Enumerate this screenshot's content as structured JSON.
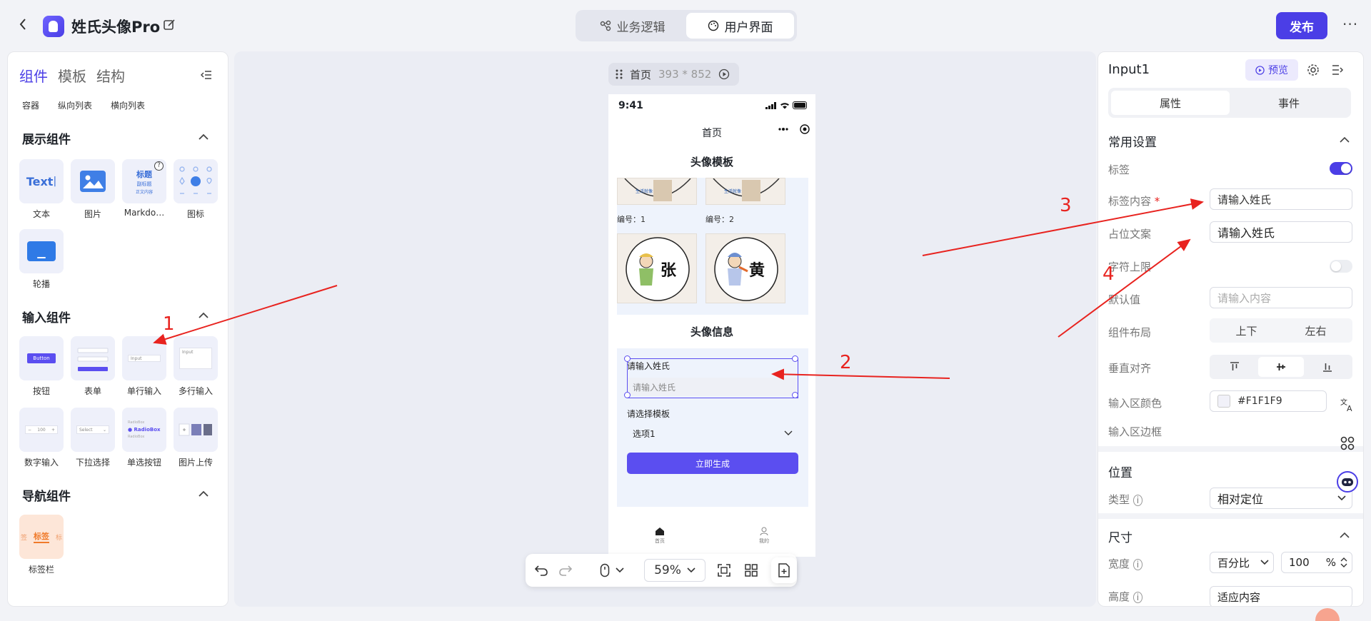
{
  "header": {
    "app_title": "姓氏头像Pro",
    "modes": [
      "业务逻辑",
      "用户界面"
    ],
    "publish_label": "发布",
    "more_label": "···"
  },
  "left_panel": {
    "tabs": [
      "组件",
      "模板",
      "结构"
    ],
    "layout_items": [
      "容器",
      "纵向列表",
      "横向列表"
    ],
    "display_section": {
      "title": "展示组件",
      "items": [
        "文本",
        "图片",
        "Markdo…",
        "图标",
        "轮播"
      ],
      "text_sample": "Text",
      "markdown_sample": [
        "标题",
        "副标题",
        "正文内容"
      ]
    },
    "input_section": {
      "title": "输入组件",
      "items": [
        "按钮",
        "表单",
        "单行输入",
        "多行输入",
        "数字输入",
        "下拉选择",
        "单选按钮",
        "图片上传"
      ],
      "button_sample": "Button",
      "input_sample": "Input",
      "number_sample": "100",
      "select_sample": "Select",
      "radio_sample": "RadioBox"
    },
    "nav_section": {
      "title": "导航组件",
      "items": [
        "标签栏"
      ],
      "tab_sample": [
        "签",
        "标签",
        "标"
      ]
    }
  },
  "canvas": {
    "page_name": "首页",
    "page_size": "393 * 852",
    "zoom": "59%",
    "phone": {
      "time": "9:41",
      "nav_title": "首页",
      "gallery_title": "头像模板",
      "gallery_items": [
        {
          "num": "编号：1",
          "char": "张"
        },
        {
          "num": "编号：2",
          "char": "黄"
        }
      ],
      "info_title": "头像信息",
      "surname_label": "请输入姓氏",
      "surname_placeholder": "请输入姓氏",
      "template_label": "请选择模板",
      "template_value": "选项1",
      "generate_label": "立即生成",
      "tabs": [
        "首页",
        "我的"
      ]
    }
  },
  "right_panel": {
    "component_name": "Input1",
    "preview_label": "预览",
    "tabs": [
      "属性",
      "事件"
    ],
    "common": {
      "title": "常用设置",
      "label_toggle_label": "标签",
      "label_toggle_on": true,
      "label_content_label": "标签内容",
      "label_content_value": "请输入姓氏",
      "placeholder_label": "占位文案",
      "placeholder_value": "请输入姓氏",
      "maxlen_label": "字符上限",
      "maxlen_on": false,
      "default_label": "默认值",
      "default_placeholder": "请输入内容",
      "layout_label": "组件布局",
      "layout_options": [
        "上下",
        "左右"
      ],
      "valign_label": "垂直对齐",
      "bg_label": "输入区颜色",
      "bg_value": "#F1F1F9",
      "border_label": "输入区边框"
    },
    "position": {
      "title": "位置",
      "type_label": "类型",
      "type_value": "相对定位"
    },
    "size": {
      "title": "尺寸",
      "width_label": "宽度",
      "width_unit_type": "百分比",
      "width_value": "100",
      "width_unit": "%",
      "height_label": "高度",
      "height_value": "适应内容"
    }
  },
  "annotations": [
    "1",
    "2",
    "3",
    "4"
  ],
  "colors": {
    "accent": "#4b3ee6",
    "annotation": "#e8231f",
    "canvas_bg": "#ebedf4",
    "form_bg": "#eef3fc"
  }
}
